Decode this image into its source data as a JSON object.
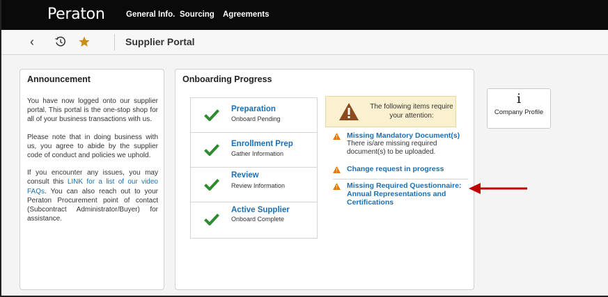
{
  "topbar": {
    "brand": "Peraton",
    "nav": [
      "General Info.",
      "Sourcing",
      "Agreements"
    ]
  },
  "toolbar": {
    "back_icon": "chevron-left-icon",
    "history_icon": "history-icon",
    "favorite_icon": "star-icon",
    "title": "Supplier Portal"
  },
  "announcement": {
    "title": "Announcement",
    "p1": "You have now logged onto our supplier portal. This portal is the one-stop shop for all of your business transactions with us.",
    "p2": "Please note that in doing business with us, you agree to abide by the supplier code of conduct and policies we uphold.",
    "p3_before": "If you encounter any issues, you may consult this ",
    "p3_link": "LINK for a list of our video FAQs",
    "p3_after": ". You can also reach out to your Peraton Procurement point of contact (Subcontract Administrator/Buyer) for assistance."
  },
  "onboarding": {
    "title": "Onboarding Progress",
    "steps": [
      {
        "title": "Preparation",
        "subtitle": "Onboard Pending"
      },
      {
        "title": "Enrollment Prep",
        "subtitle": "Gather Information"
      },
      {
        "title": "Review",
        "subtitle": "Review Information"
      },
      {
        "title": "Active Supplier",
        "subtitle": "Onboard Complete"
      }
    ],
    "alert_text": "The following items require your attention:",
    "items": [
      {
        "title": "Missing Mandatory Document(s)",
        "desc": "There is/are missing required document(s) to be uploaded."
      },
      {
        "title": "Change request in progress",
        "desc": ""
      },
      {
        "title": "Missing Required Questionnaire: Annual Representations and Certifications",
        "desc": ""
      }
    ]
  },
  "company_profile": {
    "icon": "info-icon",
    "icon_glyph": "i",
    "label": "Company Profile"
  },
  "colors": {
    "topbar": "#0a0a0a",
    "link": "#1a6fb5",
    "check": "#2e8b2e",
    "warning": "#e07a10",
    "alert_bg": "#fbf0cf",
    "alert_icon": "#8b4a1c",
    "arrow": "#c00000"
  }
}
